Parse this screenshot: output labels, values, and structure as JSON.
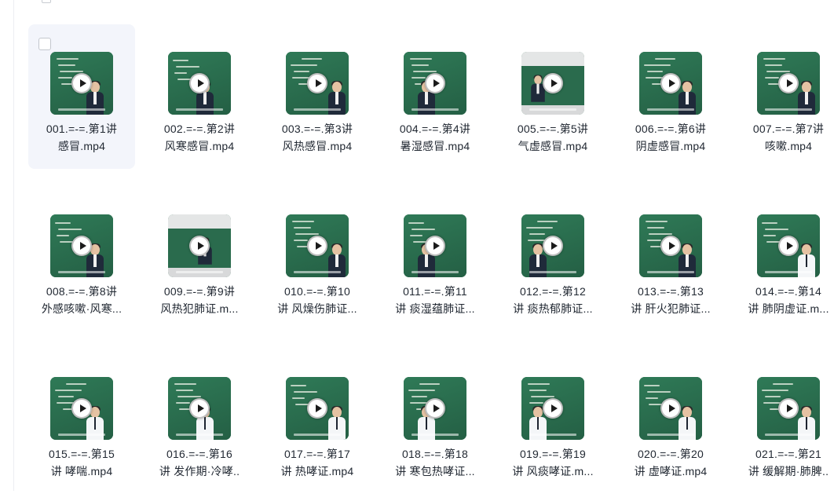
{
  "colors": {
    "board_green": "#2c6b4e",
    "selected_tile_bg": "#f3f5fb",
    "text": "#222933"
  },
  "files": [
    {
      "line1": "001.=-=.第1讲",
      "line2": "感冒.mp4",
      "selected": true
    },
    {
      "line1": "002.=-=.第2讲",
      "line2": "风寒感冒.mp4"
    },
    {
      "line1": "003.=-=.第3讲",
      "line2": "风热感冒.mp4"
    },
    {
      "line1": "004.=-=.第4讲",
      "line2": "暑湿感冒.mp4"
    },
    {
      "line1": "005.=-=.第5讲",
      "line2": "气虚感冒.mp4",
      "variant": "classroom"
    },
    {
      "line1": "006.=-=.第6讲",
      "line2": "阴虚感冒.mp4"
    },
    {
      "line1": "007.=-=.第7讲",
      "line2": "咳嗽.mp4"
    },
    {
      "line1": "008.=-=.第8讲",
      "line2": "外感咳嗽·风寒..."
    },
    {
      "line1": "009.=-=.第9讲",
      "line2": "风热犯肺证.m...",
      "variant": "classroom"
    },
    {
      "line1": "010.=-=.第10",
      "line2": "讲 风燥伤肺证..."
    },
    {
      "line1": "011.=-=.第11",
      "line2": "讲 痰湿蕴肺证..."
    },
    {
      "line1": "012.=-=.第12",
      "line2": "讲 痰热郁肺证..."
    },
    {
      "line1": "013.=-=.第13",
      "line2": "讲 肝火犯肺证..."
    },
    {
      "line1": "014.=-=.第14",
      "line2": "讲 肺阴虚证.m...",
      "variant": "light"
    },
    {
      "line1": "015.=-=.第15",
      "line2": "讲 哮喘.mp4",
      "variant": "light"
    },
    {
      "line1": "016.=-=.第16",
      "line2": "讲 发作期·冷哮..",
      "variant": "light"
    },
    {
      "line1": "017.=-=.第17",
      "line2": "讲 热哮证.mp4",
      "variant": "light"
    },
    {
      "line1": "018.=-=.第18",
      "line2": "讲 寒包热哮证...",
      "variant": "light"
    },
    {
      "line1": "019.=-=.第19",
      "line2": "讲 风痰哮证.m...",
      "variant": "light"
    },
    {
      "line1": "020.=-=.第20",
      "line2": "讲 虚哮证.mp4",
      "variant": "light"
    },
    {
      "line1": "021.=-=.第21",
      "line2": "讲 缓解期·肺脾..",
      "variant": "light"
    }
  ],
  "icons": {
    "play": "play-icon",
    "checkbox": "checkbox-icon"
  }
}
